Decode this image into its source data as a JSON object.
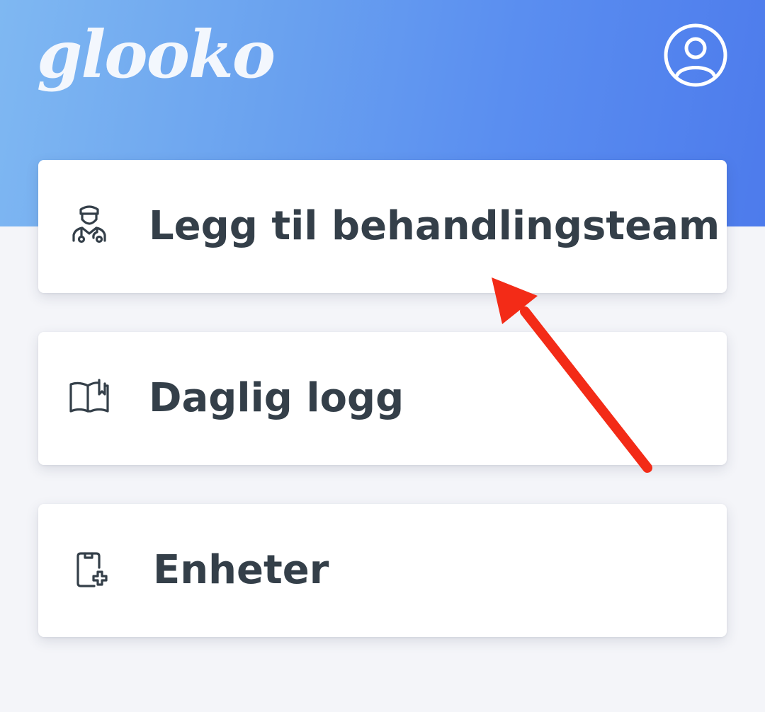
{
  "header": {
    "logo_text": "glooko",
    "profile_icon": "account-circle-icon",
    "gradient_colors": [
      "#7fb8f2",
      "#4d7bec"
    ]
  },
  "menu": {
    "items": [
      {
        "label": "Legg til behandlingsteam",
        "icon": "care-team-doctor-icon"
      },
      {
        "label": "Daglig logg",
        "icon": "open-book-icon"
      },
      {
        "label": "Enheter",
        "icon": "device-add-icon"
      }
    ]
  },
  "colors": {
    "page_background": "#f4f5f9",
    "card_background": "#ffffff",
    "text": "#343f49",
    "annotation_arrow": "#f32b17"
  }
}
